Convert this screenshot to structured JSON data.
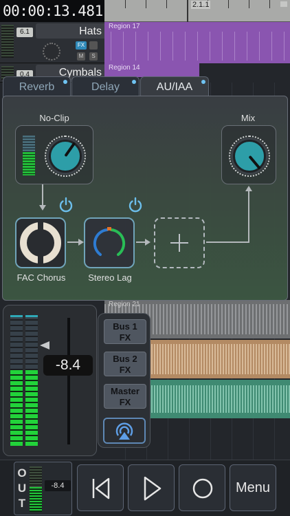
{
  "transport_time": "00:00:13.481",
  "ruler": {
    "bar_label": "2.1.1"
  },
  "tracks": [
    {
      "name": "Hats",
      "volume": "6.1",
      "region": "Region 17",
      "fx_badge": "FX",
      "mute": "M",
      "solo": "S"
    },
    {
      "name": "Cymbals",
      "volume": "0.4",
      "region": "Region 14"
    }
  ],
  "audio_region_label": "Region 21",
  "fx_panel": {
    "tabs": [
      "Reverb",
      "Delay",
      "AU/IAA"
    ],
    "active_tab": "AU/IAA",
    "no_clip_label": "No-Clip",
    "mix_label": "Mix",
    "plugins": [
      {
        "name": "FAC Chorus"
      },
      {
        "name": "Stereo Lag"
      }
    ]
  },
  "mixer": {
    "fader_value": "-8.4"
  },
  "buses": [
    {
      "line1": "Bus 1",
      "line2": "FX"
    },
    {
      "line1": "Bus 2",
      "line2": "FX"
    },
    {
      "line1": "Master",
      "line2": "FX"
    }
  ],
  "output": {
    "label": [
      "O",
      "U",
      "T"
    ],
    "value": "-8.4"
  },
  "controls": {
    "menu_label": "Menu"
  },
  "icons": {
    "power": "power-icon",
    "airplay": "airplay-icon",
    "rewind": "skip-to-start-icon",
    "play": "play-icon",
    "record": "record-icon",
    "add": "plus-icon"
  },
  "colors": {
    "accent_blue": "#6fc3f2",
    "meter_green": "#22d23a",
    "region_purple": "#8a55b0",
    "knob_teal": "#2ea2ad"
  }
}
